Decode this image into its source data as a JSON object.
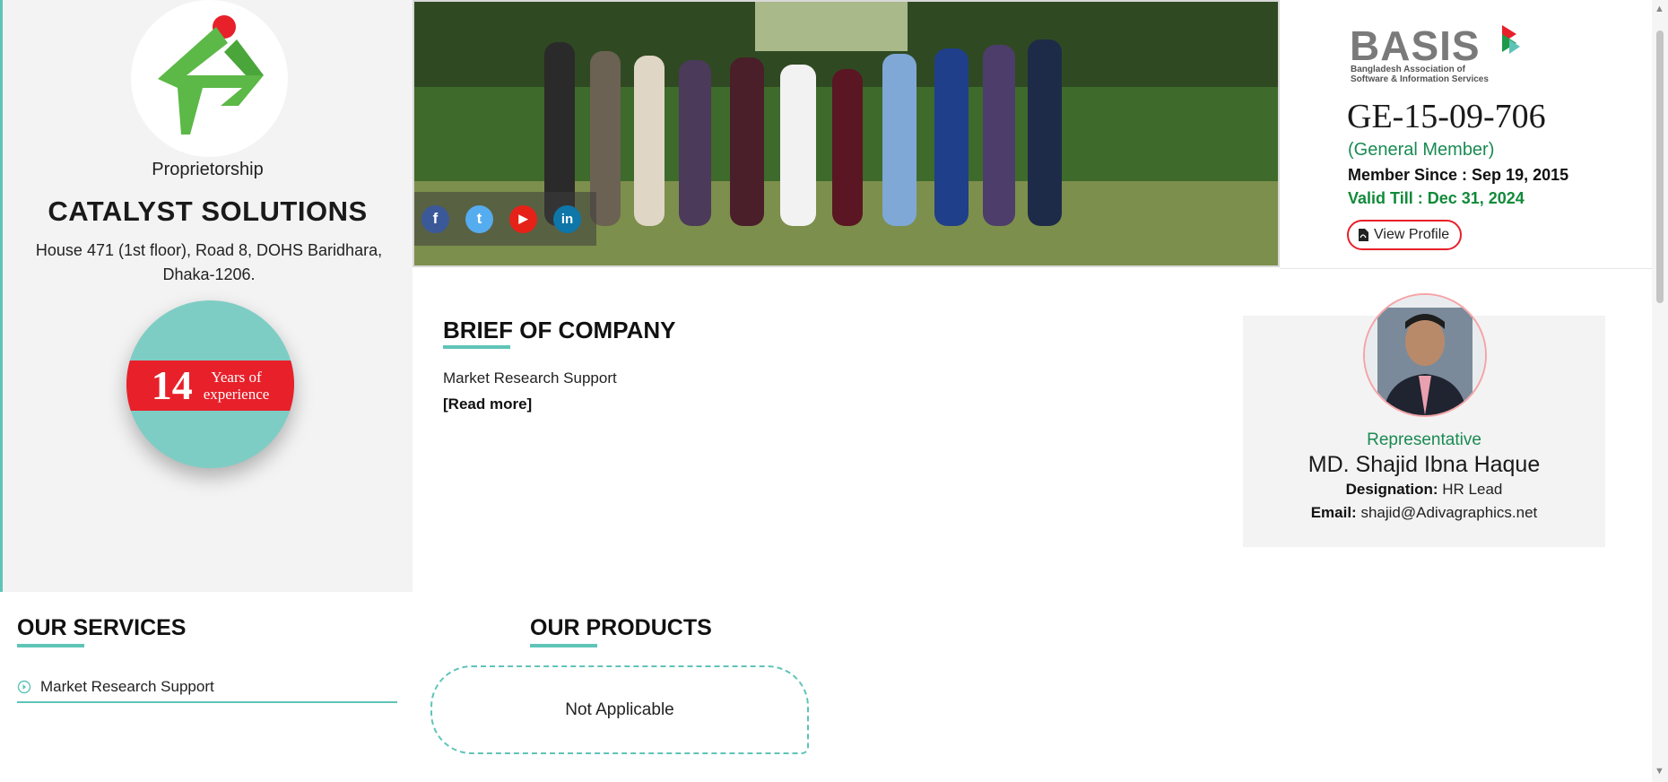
{
  "company": {
    "type": "Proprietorship",
    "name": "CATALYST SOLUTIONS",
    "address": "House 471 (1st floor), Road 8, DOHS Baridhara, Dhaka-1206."
  },
  "experience": {
    "years": "14",
    "label_line1": "Years of",
    "label_line2": "experience"
  },
  "social": [
    {
      "name": "facebook",
      "glyph": "f",
      "color": "#3b5998"
    },
    {
      "name": "twitter",
      "glyph": "t",
      "color": "#55acee"
    },
    {
      "name": "youtube",
      "glyph": "▶",
      "color": "#e62117"
    },
    {
      "name": "linkedin",
      "glyph": "in",
      "color": "#0e76a8"
    }
  ],
  "membership": {
    "logo_text": "BASIS",
    "logo_sub_line1": "Bangladesh Association of",
    "logo_sub_line2": "Software & Information Services",
    "member_id": "GE-15-09-706",
    "member_type": "(General Member)",
    "member_since": "Member Since : Sep 19, 2015",
    "valid_till": "Valid Till : Dec 31, 2024",
    "view_profile_label": "View Profile"
  },
  "brief": {
    "title": "BRIEF OF COMPANY",
    "text": "Market Research Support",
    "read_more": "[Read more]"
  },
  "representative": {
    "role": "Representative",
    "name": "MD. Shajid Ibna Haque",
    "designation_label": "Designation:",
    "designation": "HR Lead",
    "email_label": "Email:",
    "email": "shajid@Adivagraphics.net"
  },
  "services": {
    "title": "OUR SERVICES",
    "items": [
      "Market Research Support"
    ]
  },
  "products": {
    "title": "OUR PRODUCTS",
    "empty_text": "Not Applicable"
  },
  "colors": {
    "accent": "#5fc4b8",
    "brand_red": "#e8202a",
    "green_text": "#1a8a52"
  }
}
